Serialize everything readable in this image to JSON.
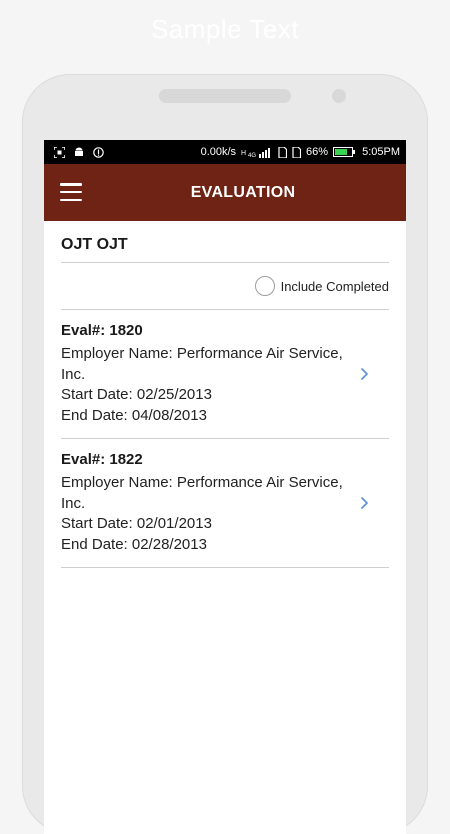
{
  "caption": "Sample Text",
  "status_bar": {
    "speed": "0.00k/s",
    "battery": "66%",
    "time": "5:05PM"
  },
  "app_bar": {
    "title": "EVALUATION"
  },
  "section": {
    "title": "OJT OJT"
  },
  "filter": {
    "label": "Include Completed",
    "checked": false
  },
  "evaluations": [
    {
      "title": "Eval#: 1820",
      "employer": "Employer Name: Performance Air Service, Inc.",
      "start": "Start Date: 02/25/2013",
      "end": "End Date: 04/08/2013"
    },
    {
      "title": "Eval#: 1822",
      "employer": "Employer Name: Performance Air Service, Inc.",
      "start": "Start Date: 02/01/2013",
      "end": "End Date: 02/28/2013"
    }
  ],
  "colors": {
    "app_bar": "#6e2314",
    "chevron": "#5b8fd6",
    "divider": "#cfcfcf"
  }
}
